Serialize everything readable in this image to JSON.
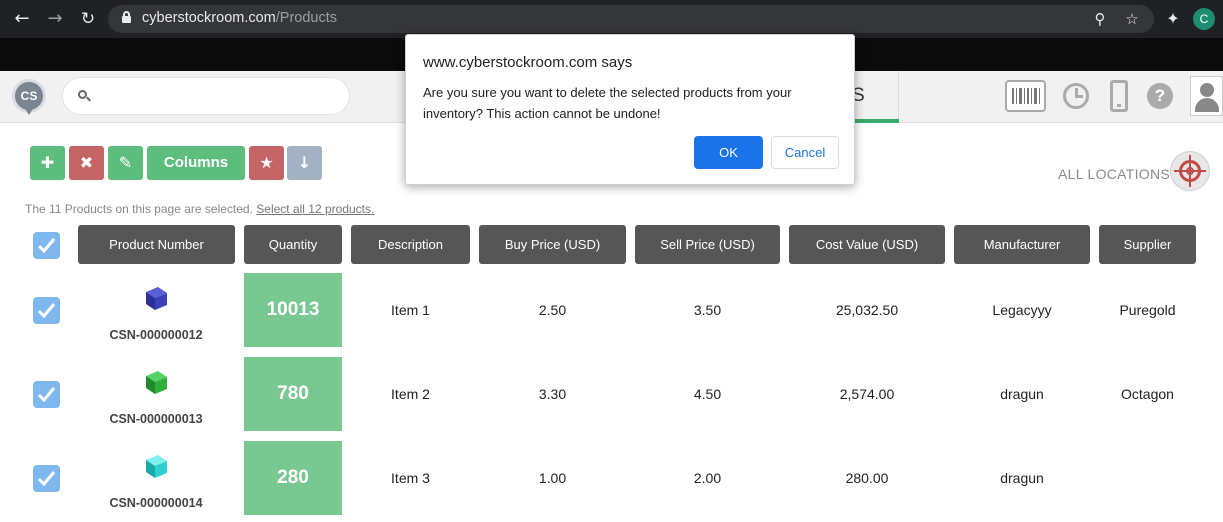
{
  "browser": {
    "url_host": "cyberstockroom.com",
    "url_path": "/Products",
    "profile_initial": "C"
  },
  "app": {
    "logo_text": "CS",
    "search": {
      "placeholder": "",
      "value": ""
    },
    "active_nav_tab_visible_text": "S"
  },
  "toolbar": {
    "columns_label": "Columns",
    "locations_label": "ALL LOCATIONS"
  },
  "selection": {
    "note": "The 11 Products on this page are selected.",
    "select_all_link": "Select all 12 products."
  },
  "table": {
    "headers": [
      "Product Number",
      "Quantity",
      "Description",
      "Buy Price (USD)",
      "Sell Price (USD)",
      "Cost Value (USD)",
      "Manufacturer",
      "Supplier"
    ],
    "rows": [
      {
        "product_number": "CSN-000000012",
        "quantity": "10013",
        "description": "Item 1",
        "buy_price": "2.50",
        "sell_price": "3.50",
        "cost_value": "25,032.50",
        "manufacturer": "Legacyyy",
        "supplier": "Puregold",
        "cube_color": "#3b3fb8",
        "checked": true
      },
      {
        "product_number": "CSN-000000013",
        "quantity": "780",
        "description": "Item 2",
        "buy_price": "3.30",
        "sell_price": "4.50",
        "cost_value": "2,574.00",
        "manufacturer": "dragun",
        "supplier": "Octagon",
        "cube_color": "#2fae3b",
        "checked": true
      },
      {
        "product_number": "CSN-000000014",
        "quantity": "280",
        "description": "Item 3",
        "buy_price": "1.00",
        "sell_price": "2.00",
        "cost_value": "280.00",
        "manufacturer": "dragun",
        "supplier": "",
        "cube_color": "#2fd0d0",
        "checked": true
      }
    ]
  },
  "dialog": {
    "title": "www.cyberstockroom.com says",
    "message": "Are you sure you want to delete the selected products from your inventory? This action cannot be undone!",
    "ok_label": "OK",
    "cancel_label": "Cancel"
  },
  "colors": {
    "accent_green": "#5cbd7d",
    "danger_red": "#c46464",
    "dialog_primary": "#1a73e8",
    "checkbox_blue": "#7fb8ef"
  }
}
